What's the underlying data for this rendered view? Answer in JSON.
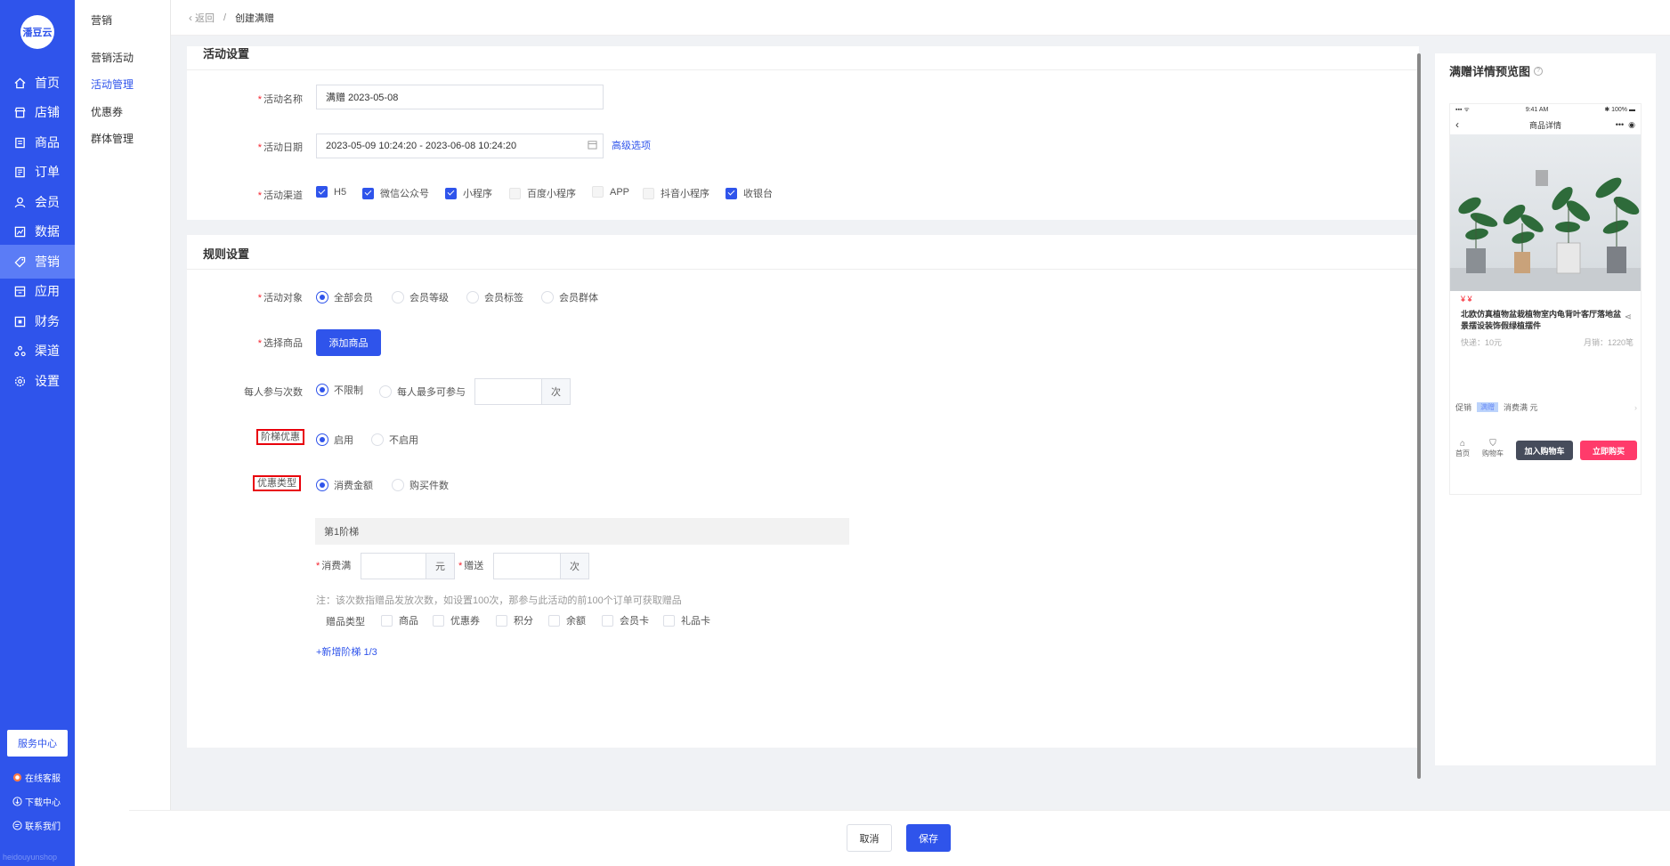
{
  "brand": {
    "logo_text": "潘豆云",
    "watermark": "heidouyunshop"
  },
  "nav": {
    "items": [
      {
        "label": "首页",
        "icon": "home-icon"
      },
      {
        "label": "店铺",
        "icon": "shop-icon"
      },
      {
        "label": "商品",
        "icon": "goods-icon"
      },
      {
        "label": "订单",
        "icon": "order-icon"
      },
      {
        "label": "会员",
        "icon": "member-icon"
      },
      {
        "label": "数据",
        "icon": "chart-icon"
      },
      {
        "label": "营销",
        "icon": "tag-icon"
      },
      {
        "label": "应用",
        "icon": "app-icon"
      },
      {
        "label": "财务",
        "icon": "finance-icon"
      },
      {
        "label": "渠道",
        "icon": "channel-icon"
      },
      {
        "label": "设置",
        "icon": "gear-icon"
      }
    ],
    "active_index": 6,
    "service_center": "服务中心",
    "links": [
      {
        "label": "在线客服",
        "icon": "chat-icon"
      },
      {
        "label": "下载中心",
        "icon": "download-icon"
      },
      {
        "label": "联系我们",
        "icon": "contact-icon"
      }
    ]
  },
  "subnav": {
    "title": "营销",
    "items": [
      "营销活动",
      "活动管理",
      "优惠券",
      "群体管理"
    ],
    "active_index": 1
  },
  "breadcrumb": {
    "back": "返回",
    "separator": "/",
    "current": "创建满赠"
  },
  "activity": {
    "section_title": "活动设置",
    "name_label": "活动名称",
    "name_value": "满赠  2023-05-08",
    "date_label": "活动日期",
    "date_value": "2023-05-09 10:24:20 - 2023-06-08 10:24:20",
    "advanced_link": "高级选项",
    "channel_label": "活动渠道",
    "channels": [
      {
        "label": "H5",
        "checked": true
      },
      {
        "label": "微信公众号",
        "checked": true
      },
      {
        "label": "小程序",
        "checked": true
      },
      {
        "label": "百度小程序",
        "checked": false
      },
      {
        "label": "APP",
        "checked": false
      },
      {
        "label": "抖音小程序",
        "checked": false
      },
      {
        "label": "收银台",
        "checked": true
      }
    ]
  },
  "rules": {
    "section_title": "规则设置",
    "target_label": "活动对象",
    "targets": [
      "全部会员",
      "会员等级",
      "会员标签",
      "会员群体"
    ],
    "goods_label": "选择商品",
    "add_goods_button": "添加商品",
    "times_label": "每人参与次数",
    "times_options": [
      "不限制",
      "每人最多可参与"
    ],
    "times_suffix": "次",
    "tier_label": "阶梯优惠",
    "tier_options": [
      "启用",
      "不启用"
    ],
    "discount_type_label": "优惠类型",
    "discount_types": [
      "消费金额",
      "购买件数"
    ],
    "tier_title": "第1阶梯",
    "spend_label": "消费满",
    "spend_suffix": "元",
    "gift_label": "赠送",
    "gift_suffix": "次",
    "note": "注：该次数指赠品发放次数，如设置100次，那参与此活动的前100个订单可获取赠品",
    "gift_type_label": "赠品类型",
    "gift_types": [
      "商品",
      "优惠券",
      "积分",
      "余额",
      "会员卡",
      "礼品卡"
    ],
    "add_tier_link": "+新增阶梯 1/3"
  },
  "footer": {
    "cancel": "取消",
    "save": "保存"
  },
  "preview": {
    "title": "满赠详情预览图",
    "status_time": "9:41 AM",
    "status_battery": "100%",
    "page_title": "商品详情",
    "price": "¥ ¥",
    "product_name": "北欧仿真植物盆栽植物室内龟背叶客厅落地盆景摆设装饰假绿植摆件",
    "shipping": "快递：10元",
    "monthly_sales": "月销：1220笔",
    "promo_label": "促销",
    "promo_tag": "满赠",
    "promo_text": "消费满 元",
    "bottom_home": "首页",
    "bottom_cart": "购物车",
    "add_cart": "加入购物车",
    "buy_now": "立即购买"
  },
  "colors": {
    "primary": "#2f54eb",
    "danger": "#f5222d",
    "buy": "#ff3b6b",
    "cart": "#464c5b"
  }
}
